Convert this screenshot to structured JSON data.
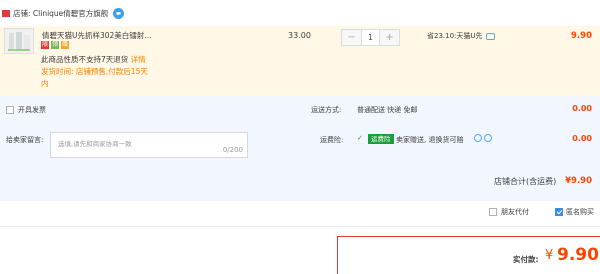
{
  "store": {
    "label": "店铺: Clinique倩碧官方旗舰"
  },
  "product": {
    "title": "倩碧天猫U先抓样302美白镭射...",
    "badges": [
      "限",
      "领",
      "赠"
    ],
    "note_grey": "此商品性质不支持7天退货 ",
    "note_orange": "详情",
    "ship_time": "发货时间: 店铺预售,付款后15天",
    "ship_time_cont": "内",
    "price": "33.00",
    "quantity": "1",
    "minus": "−",
    "plus": "+",
    "saving": "省23.10:天猫U先",
    "subtotal": "9.90"
  },
  "options": {
    "invoice_label": "开具发票",
    "shipping_label": "运送方式:",
    "shipping_value": "普通配送 快递 免邮",
    "shipping_amount": "0.00",
    "message_label": "给卖家留言:",
    "message_placeholder": "选填,请先和商家协商一致",
    "message_count": "0/200",
    "insurance_label": "运费险:",
    "insurance_check": "✓",
    "insurance_badge": "运费险",
    "insurance_text": "卖家赠送, 退换货可赔",
    "insurance_amount": "0.00",
    "total_label": "店铺合计(含运费)",
    "total_amount": "¥9.90"
  },
  "payment": {
    "friend_pay_label": "朋友代付",
    "anonymous_label": "匿名购买",
    "pay_label": "实付款:",
    "currency": "¥",
    "pay_amount": "9.90"
  },
  "colors": {
    "price_red": "#ff4400",
    "highlight_bg": "#fff8e6",
    "band_bg": "#f2f7ff",
    "accent_blue": "#3b8ee8",
    "insurance_green": "#1a9e3b"
  },
  "icons": [
    "store-icon",
    "chat-icon",
    "product-thumbnail",
    "comment-icon",
    "help-icon",
    "checkbox"
  ]
}
